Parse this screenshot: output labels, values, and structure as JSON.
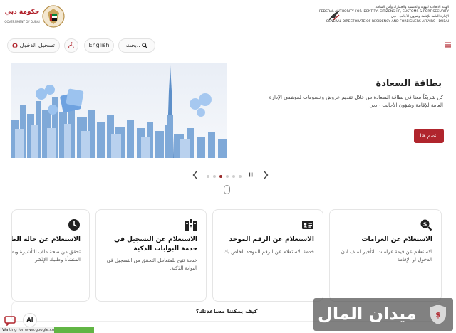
{
  "header": {
    "dubai_logo_ar": "حكومة دبي",
    "dubai_logo_en": "GOVERNMENT OF DUBAI",
    "gdrfa_lines": [
      "الهيئة الاتحادية للهوية والجنسية والجمارك وأمن المنافذ",
      "FEDERAL AUTHORITY FOR IDENTITY, CITIZENSHIP, CUSTOMS & PORT SECURITY",
      "الإدارة العامة للإقامة وشؤون الأجانب - دبي",
      "GENERAL DIRECTORATE OF RESIDENCY AND FOREIGNERS AFFAIRS - DUBAI"
    ]
  },
  "toolbar": {
    "login_label": "تسجيل الدخول",
    "language_label": "English",
    "search_placeholder": "بحث..",
    "icons": [
      "user-icon",
      "accessibility-icon",
      "search-icon",
      "menu-icon"
    ]
  },
  "hero": {
    "title": "بطاقة السعادة",
    "description": "كن شريكاً معنا في بطاقة السعادة من خلال تقديم عروض وخصومات لموظفي الإدارة العامة للإقامة وشؤون الأجانب - دبي",
    "join_label": "انضم هنا",
    "slide_count": 6,
    "active_slide": 3
  },
  "services": [
    {
      "title": "الاستعلام عن الغرامات",
      "description": "الاستعلام عن قيمة غرامات التأخير لملف اذن الدخول او الإقامة",
      "icon": "search-dollar-icon"
    },
    {
      "title": "الاستعلام عن الرقم الموحد",
      "description": "خدمة الاستعلام عن الرقم الموحد الخاص بك",
      "icon": "id-card-icon"
    },
    {
      "title": "الاستعلام عن التسجيل في خدمة البوابات الذكية",
      "description": "خدمة تتيح للمتعامل التحقق من التسجيل في البوابة الذكية.",
      "icon": "smart-gate-icon"
    },
    {
      "title": "الاستعلام عن حالة الطلبات",
      "description": "تحقق من صحة ملف التأشيرة وبطاقة المنشأة وطلبك الإلكتر",
      "icon": "clock-icon"
    }
  ],
  "help": {
    "question": "كيف يمكننا مساعدتك؟"
  },
  "floating": {
    "ai_label": "AI",
    "status_text": "Waiting for www.google.com..."
  },
  "watermark": {
    "text": "ميدان المال"
  },
  "colors": {
    "brand_red": "#b0252d",
    "progress_green": "#61b544"
  }
}
